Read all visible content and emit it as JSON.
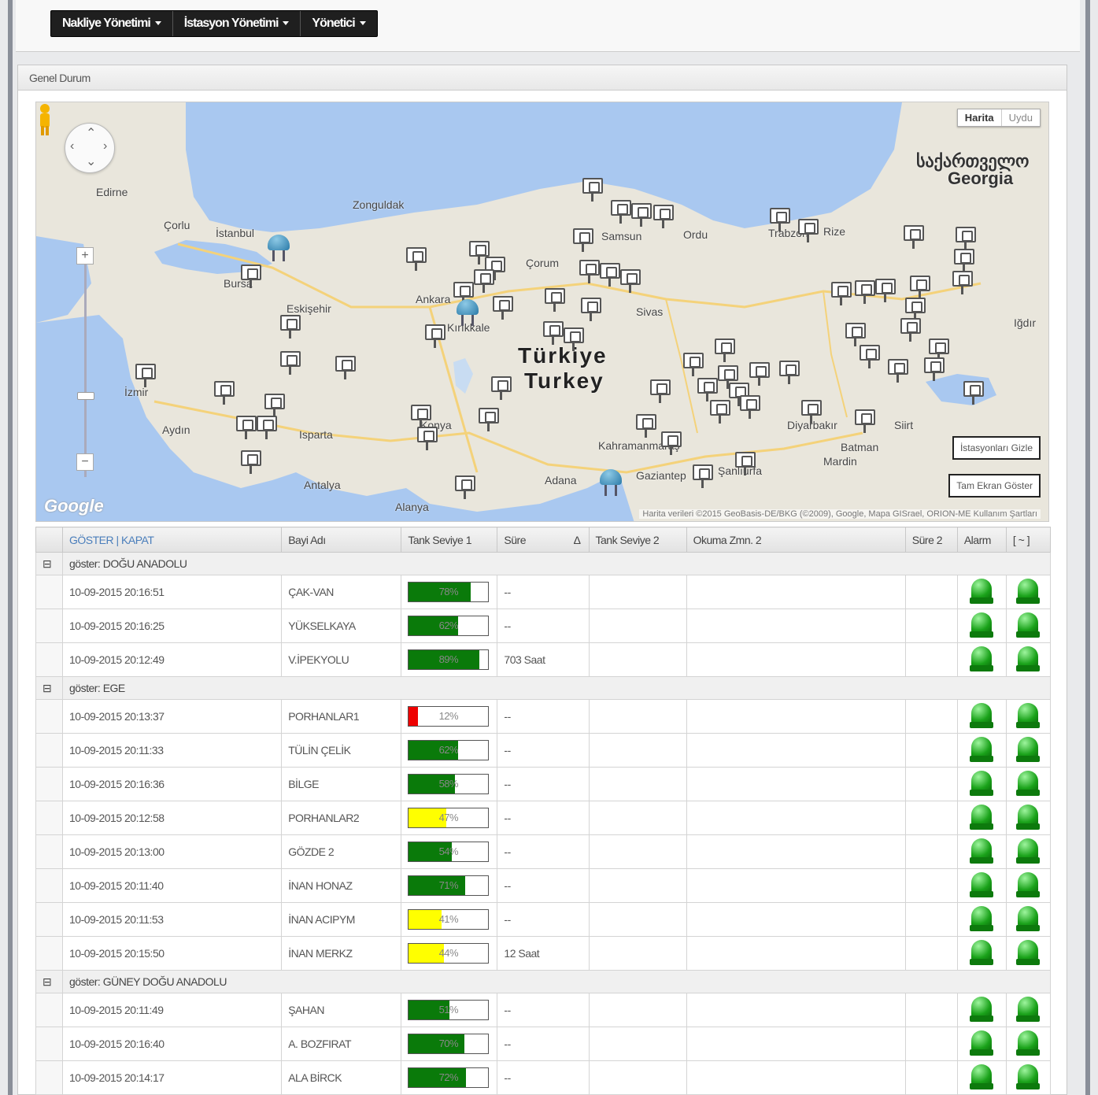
{
  "menu": [
    {
      "label": "Nakliye Yönetimi"
    },
    {
      "label": "İstasyon Yönetimi"
    },
    {
      "label": "Yönetici"
    }
  ],
  "panel": {
    "title": "Genel Durum"
  },
  "map": {
    "type_active": "Harita",
    "type_inactive": "Uydu",
    "hide_stations": "İstasyonları Gizle",
    "fullscreen": "Tam Ekran Göster",
    "google": "Google",
    "attribution": "Harita verileri ©2015 GeoBasis-DE/BKG (©2009), Google, Mapa GISrael, ORION-ME   Kullanım Şartları",
    "labels": {
      "turkiye": "Türkiye",
      "turkey": "Turkey",
      "georgia_native": "საქართველო",
      "georgia": "Georgia",
      "zonguldak": "Zonguldak",
      "edirne": "Edirne",
      "corlu": "Çorlu",
      "istanbul": "İstanbul",
      "bursa": "Bursa",
      "eskisehir": "Eskişehir",
      "ankara": "Ankara",
      "kirikkale": "Kırıkkale",
      "corum": "Çorum",
      "samsun": "Samsun",
      "ordu": "Ordu",
      "trabzon": "Trabzon",
      "rize": "Rize",
      "sivas": "Sivas",
      "izmir": "İzmir",
      "aydin": "Aydın",
      "isparta": "Isparta",
      "antalya": "Antalya",
      "alanya": "Alanya",
      "konya": "Konya",
      "adana": "Adana",
      "kahramanmaras": "Kahramanmaraş",
      "gaziantep": "Gaziantep",
      "sanliurfa": "Şanlıurfa",
      "diyarbakir": "Diyarbakır",
      "batman": "Batman",
      "mardin": "Mardin",
      "siirt": "Siirt",
      "igdir": "Iğdır"
    }
  },
  "table": {
    "headers": {
      "show_close": "GÖSTER | KAPAT",
      "dealer": "Bayi Adı",
      "tank1": "Tank Seviye 1",
      "duration": "Süre",
      "sort_icon": "Δ",
      "tank2": "Tank Seviye 2",
      "reading2": "Okuma Zmn. 2",
      "duration2": "Süre 2",
      "alarm": "Alarm",
      "menu": "[ ~ ]"
    },
    "colors": {
      "green": "#0a7a0a",
      "yellow": "#ffff00",
      "red": "#ee0000"
    },
    "groups": [
      {
        "label": "göster: DOĞU ANADOLU",
        "rows": [
          {
            "time": "10-09-2015 20:16:51",
            "dealer": "ÇAK-VAN",
            "pct": 78,
            "pct_text": "78%",
            "color": "green",
            "duration": "--"
          },
          {
            "time": "10-09-2015 20:16:25",
            "dealer": "YÜKSELKAYA",
            "pct": 62,
            "pct_text": "62%",
            "color": "green",
            "duration": "--"
          },
          {
            "time": "10-09-2015 20:12:49",
            "dealer": "V.İPEKYOLU",
            "pct": 89,
            "pct_text": "89%",
            "color": "green",
            "duration": "703 Saat"
          }
        ]
      },
      {
        "label": "göster: EGE",
        "rows": [
          {
            "time": "10-09-2015 20:13:37",
            "dealer": "PORHANLAR1",
            "pct": 12,
            "pct_text": "12%",
            "color": "red",
            "duration": "--"
          },
          {
            "time": "10-09-2015 20:11:33",
            "dealer": "TÜLİN ÇELİK",
            "pct": 62,
            "pct_text": "62%",
            "color": "green",
            "duration": "--"
          },
          {
            "time": "10-09-2015 20:16:36",
            "dealer": "BİLGE",
            "pct": 58,
            "pct_text": "58%",
            "color": "green",
            "duration": "--"
          },
          {
            "time": "10-09-2015 20:12:58",
            "dealer": "PORHANLAR2",
            "pct": 47,
            "pct_text": "47%",
            "color": "yellow",
            "duration": "--"
          },
          {
            "time": "10-09-2015 20:13:00",
            "dealer": "GÖZDE 2",
            "pct": 54,
            "pct_text": "54%",
            "color": "green",
            "duration": "--"
          },
          {
            "time": "10-09-2015 20:11:40",
            "dealer": "İNAN HONAZ",
            "pct": 71,
            "pct_text": "71%",
            "color": "green",
            "duration": "--"
          },
          {
            "time": "10-09-2015 20:11:53",
            "dealer": "İNAN ACIPYM",
            "pct": 41,
            "pct_text": "41%",
            "color": "yellow",
            "duration": "--"
          },
          {
            "time": "10-09-2015 20:15:50",
            "dealer": "İNAN MERKZ",
            "pct": 44,
            "pct_text": "44%",
            "color": "yellow",
            "duration": "12 Saat"
          }
        ]
      },
      {
        "label": "göster: GÜNEY DOĞU ANADOLU",
        "rows": [
          {
            "time": "10-09-2015 20:11:49",
            "dealer": "ŞAHAN",
            "pct": 51,
            "pct_text": "51%",
            "color": "green",
            "duration": "--"
          },
          {
            "time": "10-09-2015 20:16:40",
            "dealer": "A. BOZFIRAT",
            "pct": 70,
            "pct_text": "70%",
            "color": "green",
            "duration": "--"
          },
          {
            "time": "10-09-2015 20:14:17",
            "dealer": "ALA BİRCK",
            "pct": 72,
            "pct_text": "72%",
            "color": "green",
            "duration": "--"
          }
        ]
      }
    ]
  }
}
